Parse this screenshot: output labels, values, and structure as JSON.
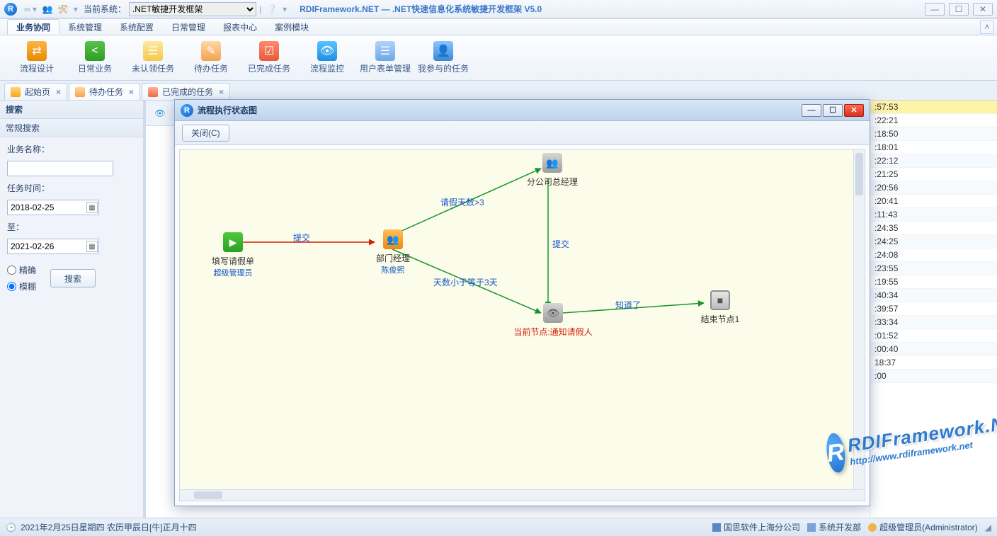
{
  "appbar": {
    "current_system_label": "当前系统：",
    "system_select_value": ".NET敏捷开发框架",
    "app_title": "RDIFramework.NET — .NET快速信息化系统敏捷开发框架 V5.0"
  },
  "menu": {
    "items": [
      "业务协同",
      "系统管理",
      "系统配置",
      "日常管理",
      "报表中心",
      "案例模块"
    ],
    "active_index": 0
  },
  "ribbon": {
    "items": [
      {
        "label": "流程设计",
        "icon": "ic-orange",
        "glyph": "⇄"
      },
      {
        "label": "日常业务",
        "icon": "ic-green",
        "glyph": "<"
      },
      {
        "label": "未认领任务",
        "icon": "ic-paper",
        "glyph": "☰"
      },
      {
        "label": "待办任务",
        "icon": "ic-note",
        "glyph": "✎"
      },
      {
        "label": "已完成任务",
        "icon": "ic-cal",
        "glyph": "☑"
      },
      {
        "label": "流程监控",
        "icon": "ic-eye",
        "glyph": "👁"
      },
      {
        "label": "用户表单管理",
        "icon": "ic-form",
        "glyph": "☰"
      },
      {
        "label": "我参与的任务",
        "icon": "ic-user",
        "glyph": "👤"
      }
    ]
  },
  "doctabs": {
    "tabs": [
      {
        "label": "起始页",
        "close": true
      },
      {
        "label": "待办任务",
        "close": true,
        "active": true
      },
      {
        "label": "已完成的任务",
        "close": true
      }
    ]
  },
  "search": {
    "panel_label": "搜索",
    "section_label": "常规搜索",
    "biz_name_label": "业务名称：",
    "biz_name_value": "",
    "task_time_label": "任务时间：",
    "date_from": "2018-02-25",
    "to_label": "至：",
    "date_to": "2021-02-26",
    "radio_exact": "精确",
    "radio_fuzzy": "模糊",
    "radio_selected": "fuzzy",
    "search_btn": "搜索"
  },
  "rightcol": {
    "rows": [
      ":57:53",
      ":22:21",
      ":18:50",
      ":18:01",
      ":22:12",
      ":21:25",
      ":20:56",
      ":20:41",
      ":11:43",
      ":24:35",
      ":24:25",
      ":24:08",
      ":23:55",
      ":19:55",
      ":40:34",
      ":39:57",
      ":33:34",
      ":01:52",
      ":00:40",
      "18:37",
      ":00"
    ],
    "selected_index": 0
  },
  "dialog": {
    "title": "流程执行状态图",
    "close_btn": "关闭(C)",
    "nodes": {
      "start": {
        "title": "填写请假单",
        "sub": "超级管理员"
      },
      "dept": {
        "title": "部门经理",
        "sub": "陈俊熙"
      },
      "branch": {
        "title": "分公司总经理",
        "sub": ""
      },
      "notify": {
        "title": "当前节点:通知请假人",
        "sub": ""
      },
      "end": {
        "title": "结束节点1",
        "sub": ""
      }
    },
    "edges": {
      "e1": "提交",
      "e2": "请假天数>3",
      "e3": "天数小于等于3天",
      "e4": "提交",
      "e5": "知道了"
    }
  },
  "status": {
    "clock_text": "2021年2月25日星期四 农历甲辰日[牛]正月十四",
    "company": "国思软件上海分公司",
    "dept": "系统开发部",
    "user": "超级管理员(Administrator)"
  },
  "watermark": {
    "brand": "RDIFramework.NET",
    "url": "http://www.rdiframework.net"
  }
}
